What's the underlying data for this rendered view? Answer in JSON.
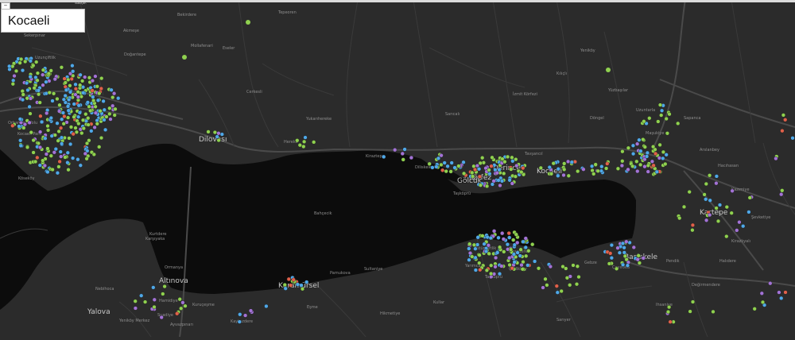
{
  "title": "Kocaeli",
  "collapse_symbol": "–",
  "colors": {
    "land": "#2b2b2b",
    "water": "#0c0c0c",
    "road_major": "#4a4a4a",
    "road_minor": "#3a3a3a",
    "point_green": "#8fd14f",
    "point_blue": "#4fa8e8",
    "point_purple": "#a373d6",
    "point_red": "#e0604a"
  },
  "place_labels": {
    "major": [
      "Dilovası",
      "Gölcük",
      "Derince",
      "Kocaeli",
      "Körfez",
      "Başiskele",
      "Kartepe",
      "Karamürsel",
      "Altınova",
      "Yalova"
    ],
    "minor": [
      "Balçık",
      "Sekerpınar",
      "Tepeoren",
      "Mollafenari",
      "Cerkesli",
      "Yukarıhereke",
      "Hereke",
      "Kiraztepe",
      "Diliskelesi",
      "Tavşancıl",
      "Taşköprü",
      "Sarıcalı",
      "Bahçecik",
      "İzmit Körfezi",
      "Yeniköy",
      "Kılıçlı",
      "Yüzbaşılar",
      "Döngel",
      "Uzuntarla",
      "Maşukiye",
      "Sapanca",
      "Arslanbey",
      "Hacıhasan",
      "Kazımiye",
      "Şevketiye",
      "Kirazlıyalı",
      "Halıdere",
      "Değirmendere",
      "Ihsaniye",
      "Sarıyer",
      "Çiftlikköy",
      "Taşköprü",
      "Yarımca",
      "Tütünçiftlik",
      "Kirazdere",
      "Kullar",
      "Hikmetiye",
      "Sultaniye",
      "Pamukova",
      "Eşme",
      "Kaytazdere",
      "Hamidiye",
      "Yeniköy Merkez",
      "Suadiye",
      "Ayvazpınarı",
      "Kuruçeşme",
      "Nebihoca",
      "Ormanya",
      "Karşıyaka",
      "Kurtdere",
      "Eseler",
      "Bekirdere",
      "Akmeşe",
      "Doğantepe",
      "Orhangazi Yolu",
      "Kocaeli Park",
      "Köseköy",
      "Uzunçiftlik",
      "Gebze",
      "Çayırova",
      "Pendik",
      "Tuzla"
    ]
  },
  "point_categories": [
    "green",
    "blue",
    "purple",
    "red"
  ]
}
